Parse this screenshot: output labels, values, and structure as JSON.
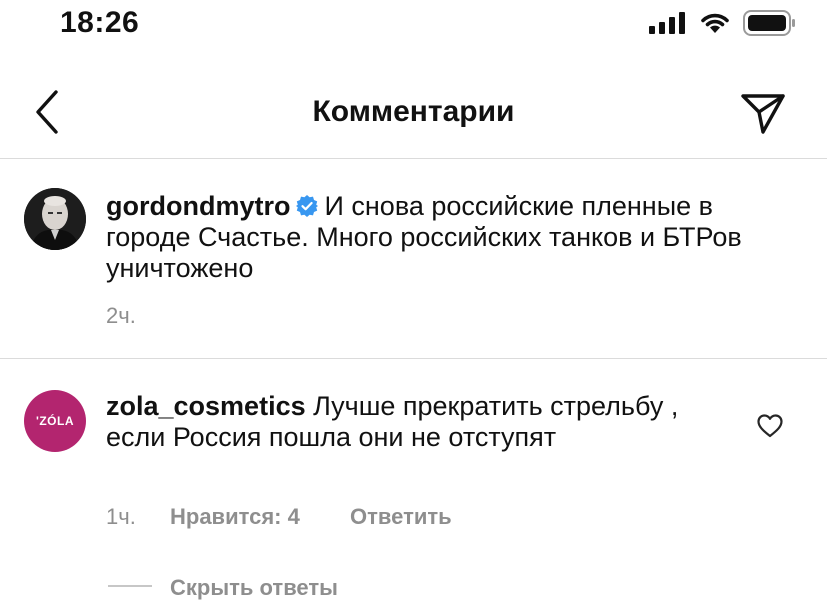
{
  "status_bar": {
    "time": "18:26"
  },
  "header": {
    "title": "Комментарии"
  },
  "post": {
    "username": "gordondmytro",
    "text": "И снова российские пленные в городе Счастье. Много российских танков и БТРов уничтожено",
    "time": "2ч."
  },
  "comment": {
    "avatar_text": "'ZÓLA",
    "username": "zola_cosmetics",
    "text": "Лучше прекратить стрельбу , если Россия пошла они не отступят",
    "time": "1ч.",
    "likes": "Нравится: 4",
    "reply": "Ответить",
    "hide_replies": "Скрыть ответы"
  },
  "colors": {
    "verified": "#3897f0",
    "zola_brand": "#b3256f",
    "muted": "#8e8e8e",
    "divider": "#dbdbdb"
  },
  "icons": [
    "signal-icon",
    "wifi-icon",
    "battery-icon",
    "back-chevron-icon",
    "send-icon",
    "verified-badge-icon",
    "heart-icon"
  ]
}
